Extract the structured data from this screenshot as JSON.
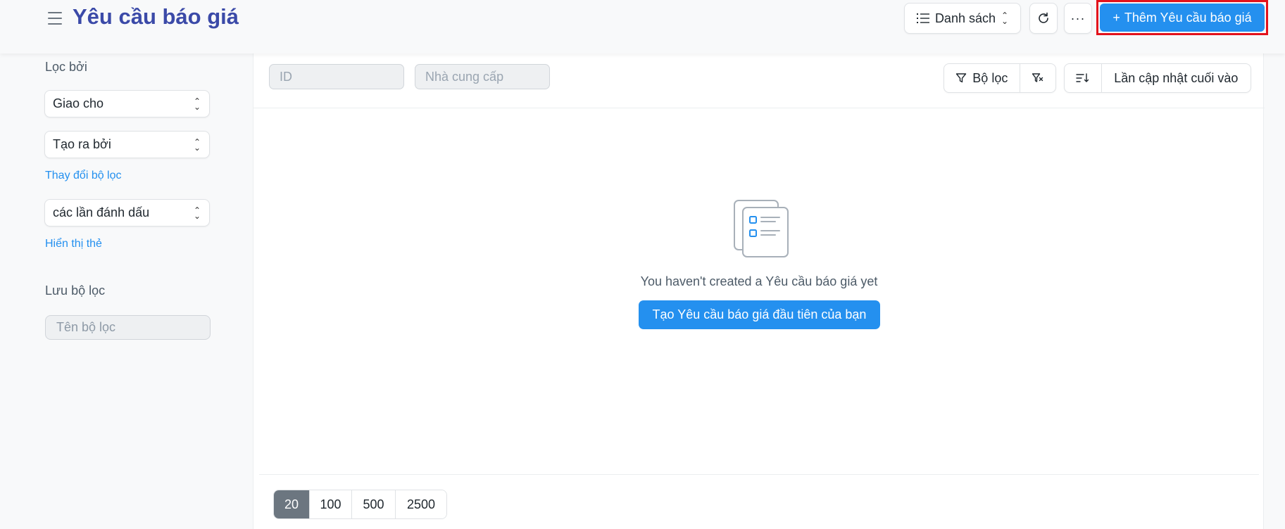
{
  "header": {
    "title": "Yêu cầu báo giá",
    "view_label": "Danh sách",
    "more_label": "···",
    "add_label": "Thêm Yêu cầu báo giá",
    "add_plus": "+"
  },
  "sidebar": {
    "filter_by_label": "Lọc bởi",
    "assigned_to": "Giao cho",
    "created_by": "Tạo ra bởi",
    "edit_filters_link": "Thay đổi bộ lọc",
    "tags": "các lần đánh dấu",
    "show_tags_link": "Hiển thị thẻ",
    "save_filter_label": "Lưu bộ lọc",
    "filter_name_placeholder": "Tên bộ lọc"
  },
  "filters": {
    "id_placeholder": "ID",
    "supplier_placeholder": "Nhà cung cấp",
    "filter_label": "Bộ lọc",
    "sort_label": "Lần cập nhật cuối vào"
  },
  "empty_state": {
    "message": "You haven't created a Yêu cầu báo giá yet",
    "create_label": "Tạo Yêu cầu báo giá đầu tiên của bạn"
  },
  "pagination": {
    "options": [
      "20",
      "100",
      "500",
      "2500"
    ],
    "selected": "20"
  },
  "colors": {
    "primary": "#2490ef",
    "title": "#3b4aa8",
    "highlight_border": "#e3121c",
    "active_page": "#6c7680"
  }
}
